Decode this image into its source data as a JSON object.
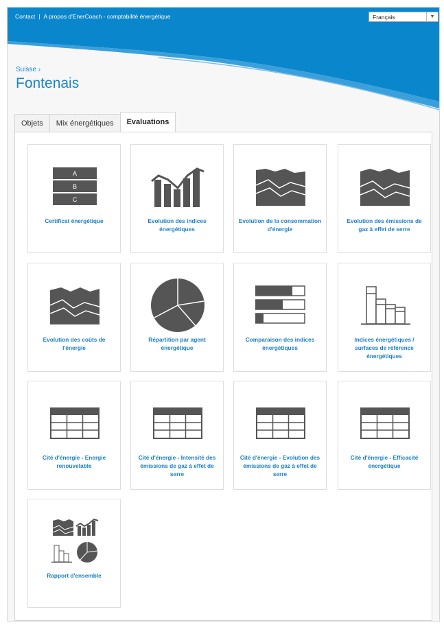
{
  "header": {
    "contact": "Contact",
    "separator": "|",
    "about": "A propos d'EnerCoach - comptabilité énergétique",
    "language": "Français",
    "accent_color": "#0a86cc"
  },
  "breadcrumb": "Suisse ›",
  "page_title": "Fontenais",
  "tabs": [
    {
      "label": "Objets",
      "active": false
    },
    {
      "label": "Mix énergétiques",
      "active": false
    },
    {
      "label": "Evaluations",
      "active": true
    }
  ],
  "cards": [
    {
      "label": "Certificat énergétique",
      "icon": "certificate-abc-icon"
    },
    {
      "label": "Evolution des indices énergétiques",
      "icon": "bar-line-chart-icon"
    },
    {
      "label": "Evolution de la consommation d'énergie",
      "icon": "area-chart-icon"
    },
    {
      "label": "Evolution des émissions de gaz à effet de serre",
      "icon": "area-chart-icon"
    },
    {
      "label": "Evolution des coûts de l'énergie",
      "icon": "area-chart-icon"
    },
    {
      "label": "Répartition par agent énergétique",
      "icon": "pie-chart-icon"
    },
    {
      "label": "Comparaison des indices énergétiques",
      "icon": "horizontal-bar-icon"
    },
    {
      "label": "Indices énergétiques / surfaces de référence énergétiques",
      "icon": "column-outline-icon"
    },
    {
      "label": "Cité d'énergie - Energie renouvelable",
      "icon": "table-icon"
    },
    {
      "label": "Cité d'énergie - Intensité des émissions de gaz à effet de serre",
      "icon": "table-icon"
    },
    {
      "label": "Cité d'énergie - Evolution des émissions de gaz à effet de serre",
      "icon": "table-icon"
    },
    {
      "label": "Cité d'énergie - Efficacité énergétique",
      "icon": "table-icon"
    },
    {
      "label": "Rapport d'ensemble",
      "icon": "overview-report-icon"
    }
  ],
  "certificate_letters": [
    "A",
    "B",
    "C"
  ]
}
